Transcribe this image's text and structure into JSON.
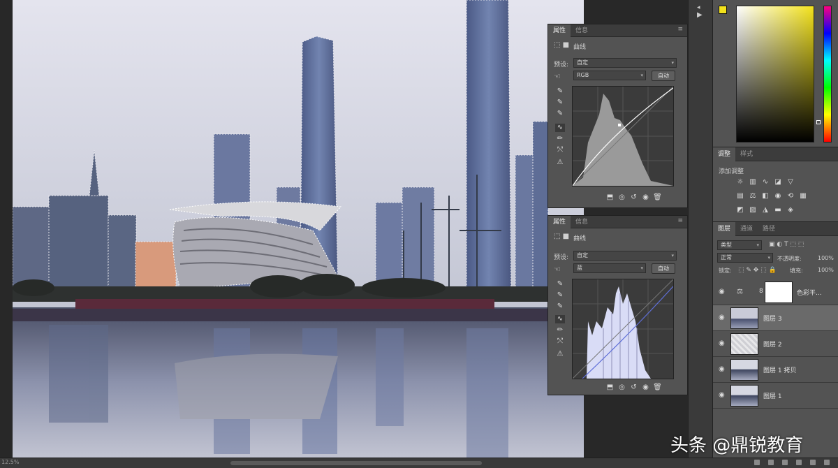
{
  "status": {
    "zoom": "12.5%"
  },
  "props_top": {
    "tabs": [
      "属性",
      "信息"
    ],
    "title": "曲线",
    "preset_label": "预设:",
    "preset_value": "自定",
    "channel_value": "RGB",
    "auto_label": "自动"
  },
  "props_bottom": {
    "tabs": [
      "属性",
      "信息"
    ],
    "title": "曲线",
    "preset_label": "预设:",
    "preset_value": "自定",
    "channel_value": "蓝",
    "auto_label": "自动"
  },
  "adjust": {
    "tabs": [
      "调整",
      "样式"
    ],
    "hint": "添加调整"
  },
  "layers": {
    "tabs": [
      "图层",
      "通道",
      "路径"
    ],
    "filter": "类型",
    "blend_mode": "正常",
    "opacity_label": "不透明度:",
    "opacity_value": "100%",
    "lock_label": "锁定:",
    "fill_label": "填充:",
    "fill_value": "100%",
    "items": [
      {
        "name": "色彩平..."
      },
      {
        "name": "图层 3"
      },
      {
        "name": "图层 2"
      },
      {
        "name": "图层 1 拷贝"
      },
      {
        "name": "图层 1"
      }
    ]
  },
  "colors": {
    "fg": "#f3e21c",
    "bg": "#ffffff",
    "panel": "#535353"
  },
  "watermark": "头条 @鼎锐教育"
}
